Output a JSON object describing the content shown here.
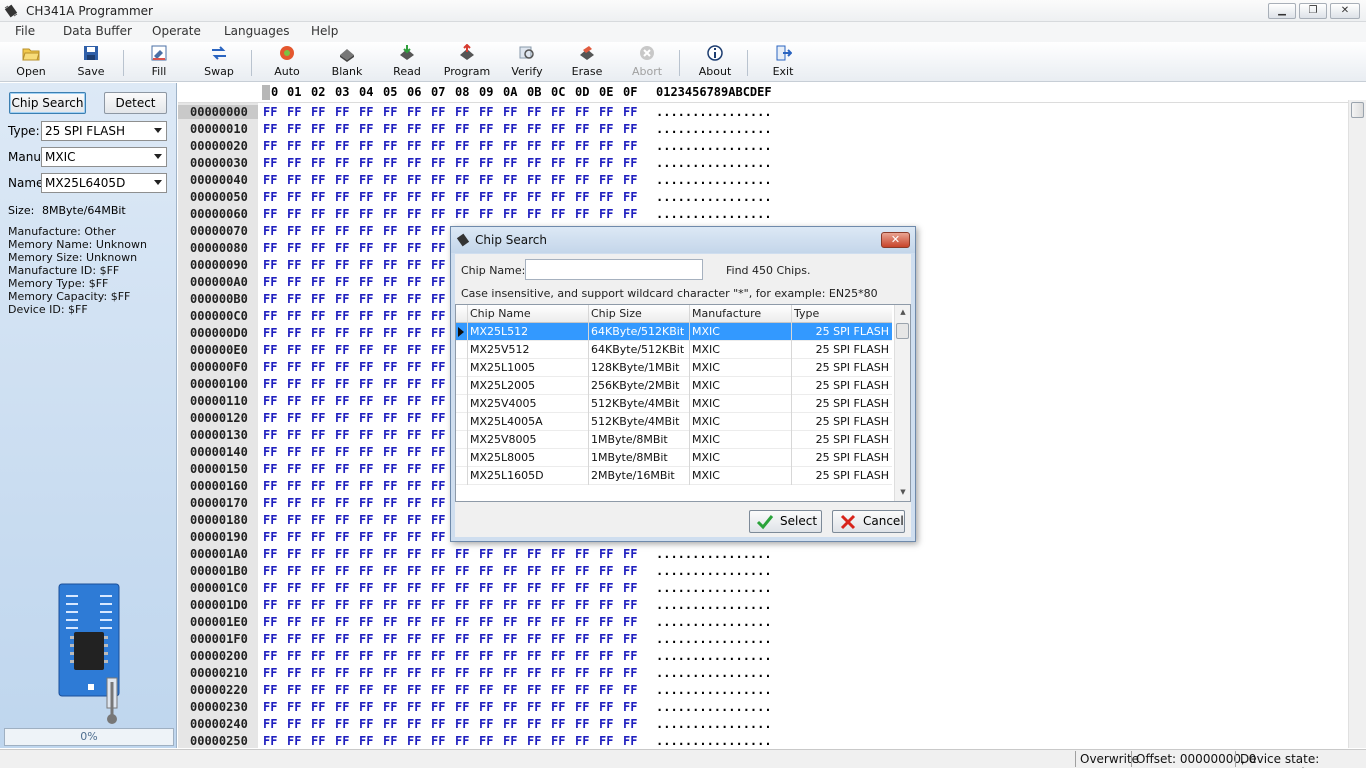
{
  "window": {
    "title": "CH341A Programmer",
    "minimize": "▁",
    "restore": "❐",
    "close": "✕"
  },
  "menu": [
    "File",
    "Data Buffer",
    "Operate",
    "Languages",
    "Help"
  ],
  "toolbar": [
    {
      "label": "Open",
      "icon": "folder-open-icon",
      "enabled": true
    },
    {
      "label": "Save",
      "icon": "floppy-disk-icon",
      "enabled": true
    },
    {
      "label": "Fill",
      "icon": "fill-icon",
      "enabled": true
    },
    {
      "label": "Swap",
      "icon": "swap-arrows-icon",
      "enabled": true
    },
    {
      "label": "Auto",
      "icon": "auto-icon",
      "enabled": true
    },
    {
      "label": "Blank",
      "icon": "blank-check-icon",
      "enabled": true
    },
    {
      "label": "Read",
      "icon": "read-chip-icon",
      "enabled": true
    },
    {
      "label": "Program",
      "icon": "program-chip-icon",
      "enabled": true
    },
    {
      "label": "Verify",
      "icon": "verify-icon",
      "enabled": true
    },
    {
      "label": "Erase",
      "icon": "erase-icon",
      "enabled": true
    },
    {
      "label": "Abort",
      "icon": "abort-icon",
      "enabled": false
    },
    {
      "label": "About",
      "icon": "info-icon",
      "enabled": true
    },
    {
      "label": "Exit",
      "icon": "exit-icon",
      "enabled": true
    }
  ],
  "left": {
    "chip_search": "Chip Search",
    "detect": "Detect",
    "type_label": "Type:",
    "type_value": "25 SPI FLASH",
    "manu_label": "Manu:",
    "manu_value": "MXIC",
    "name_label": "Name:",
    "name_value": "MX25L6405D",
    "size_label": "Size:",
    "size_value": "8MByte/64MBit",
    "info": [
      "Manufacture: Other",
      "Memory Name: Unknown",
      "Memory Size: Unknown",
      "Manufacture ID: $FF",
      "Memory Type: $FF",
      "Memory Capacity: $FF",
      "Device ID: $FF"
    ],
    "progress": "0%"
  },
  "hex": {
    "columns": [
      "0",
      "01",
      "02",
      "03",
      "04",
      "05",
      "06",
      "07",
      "08",
      "09",
      "0A",
      "0B",
      "0C",
      "0D",
      "0E",
      "0F"
    ],
    "first_col_full": "00",
    "ascii_header": "0123456789ABCDEF",
    "byte": "FF",
    "ascii": "................",
    "addresses": [
      "00000000",
      "00000010",
      "00000020",
      "00000030",
      "00000040",
      "00000050",
      "00000060",
      "00000070",
      "00000080",
      "00000090",
      "000000A0",
      "000000B0",
      "000000C0",
      "000000D0",
      "000000E0",
      "000000F0",
      "00000100",
      "00000110",
      "00000120",
      "00000130",
      "00000140",
      "00000150",
      "00000160",
      "00000170",
      "00000180",
      "00000190",
      "000001A0",
      "000001B0",
      "000001C0",
      "000001D0",
      "000001E0",
      "000001F0",
      "00000200",
      "00000210",
      "00000220",
      "00000230",
      "00000240",
      "00000250"
    ]
  },
  "dialog": {
    "title": "Chip Search",
    "chip_name_label": "Chip Name:",
    "chip_name_value": "",
    "found": "Find 450 Chips.",
    "hint": "Case insensitive, and support wildcard character \"*\", for example: EN25*80",
    "headers": [
      "Chip Name",
      "Chip Size",
      "Manufacture",
      "Type"
    ],
    "rows": [
      [
        "MX25L512",
        "64KByte/512KBit",
        "MXIC",
        "25 SPI FLASH"
      ],
      [
        "MX25V512",
        "64KByte/512KBit",
        "MXIC",
        "25 SPI FLASH"
      ],
      [
        "MX25L1005",
        "128KByte/1MBit",
        "MXIC",
        "25 SPI FLASH"
      ],
      [
        "MX25L2005",
        "256KByte/2MBit",
        "MXIC",
        "25 SPI FLASH"
      ],
      [
        "MX25V4005",
        "512KByte/4MBit",
        "MXIC",
        "25 SPI FLASH"
      ],
      [
        "MX25L4005A",
        "512KByte/4MBit",
        "MXIC",
        "25 SPI FLASH"
      ],
      [
        "MX25V8005",
        "1MByte/8MBit",
        "MXIC",
        "25 SPI FLASH"
      ],
      [
        "MX25L8005",
        "1MByte/8MBit",
        "MXIC",
        "25 SPI FLASH"
      ],
      [
        "MX25L1605D",
        "2MByte/16MBit",
        "MXIC",
        "25 SPI FLASH"
      ]
    ],
    "selected_row": 0,
    "select": "Select",
    "cancel": "Cancel"
  },
  "status": {
    "mode": "Overwrite",
    "offset": "Offset: 00000000, 0",
    "device": "Device state: Connected."
  },
  "colors": {
    "hex_bytes": "#1f1fbf",
    "selection": "#3399ff",
    "panel": "#c7dbf0"
  }
}
